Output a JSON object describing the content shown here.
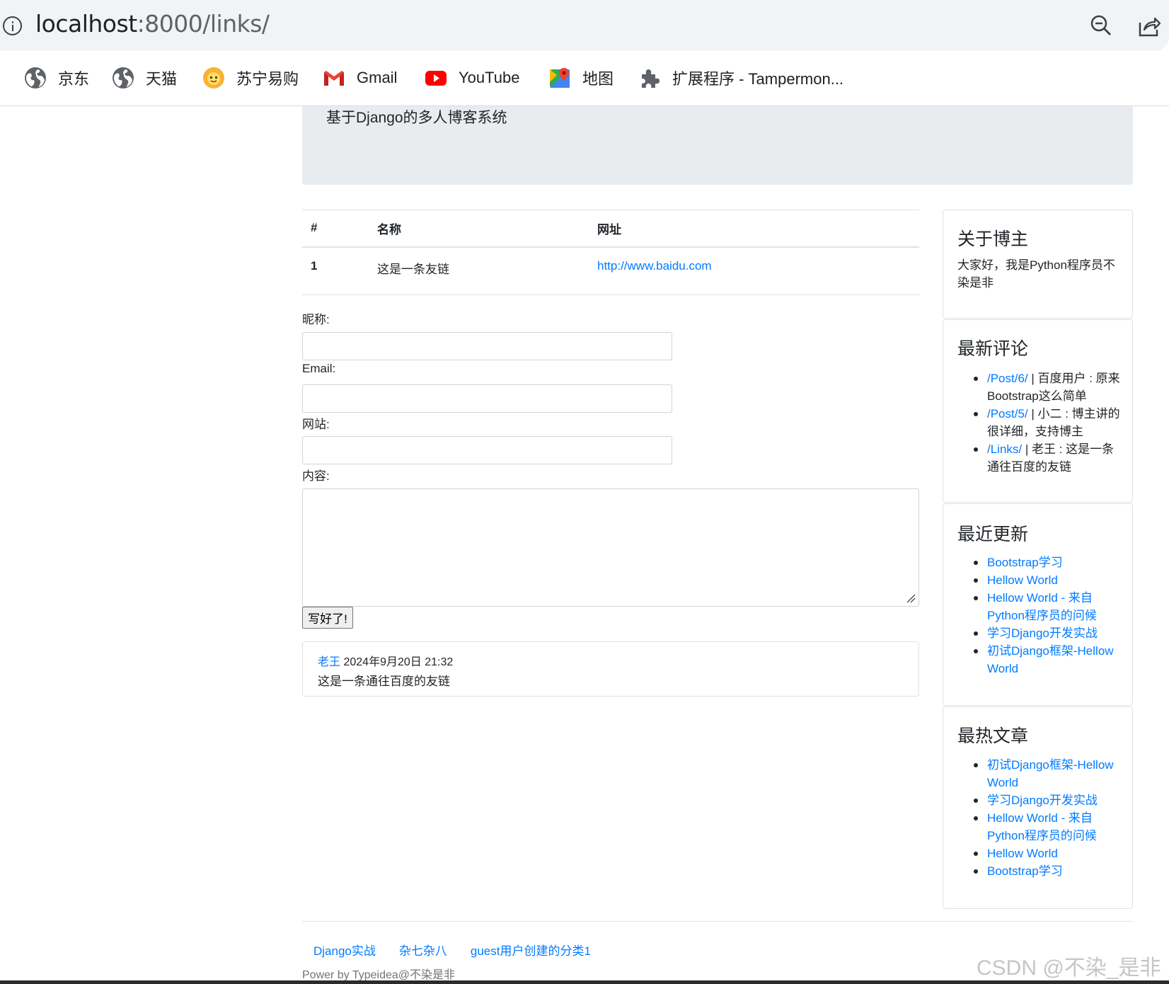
{
  "browser": {
    "url_host": "localhost",
    "url_path": ":8000/links/",
    "bookmarks": [
      {
        "label": "京东",
        "icon": "globe-icon"
      },
      {
        "label": "天猫",
        "icon": "globe-icon"
      },
      {
        "label": "苏宁易购",
        "icon": "suning-lion-icon"
      },
      {
        "label": "Gmail",
        "icon": "gmail-icon"
      },
      {
        "label": "YouTube",
        "icon": "youtube-icon"
      },
      {
        "label": "地图",
        "icon": "maps-icon"
      },
      {
        "label": "扩展程序 - Tampermon...",
        "icon": "puzzle-icon"
      }
    ]
  },
  "jumbotron": {
    "subtitle": "基于Django的多人博客系统"
  },
  "links_table": {
    "headers": [
      "#",
      "名称",
      "网址"
    ],
    "rows": [
      {
        "num": "1",
        "name": "这是一条友链",
        "url": "http://www.baidu.com"
      }
    ]
  },
  "comment_form": {
    "nickname_label": "昵称:",
    "email_label": "Email:",
    "website_label": "网站:",
    "content_label": "内容:",
    "submit_label": "写好了!"
  },
  "comments": [
    {
      "author": "老王",
      "date": "2024年9月20日 21:32",
      "content": "这是一条通往百度的友链"
    }
  ],
  "sidebar": {
    "about": {
      "title": "关于博主",
      "text": "大家好，我是Python程序员不染是非"
    },
    "latest_comments": {
      "title": "最新评论",
      "items": [
        {
          "link": "/Post/6/",
          "text": " | 百度用户 : 原来Bootstrap这么简单"
        },
        {
          "link": "/Post/5/",
          "text": " | 小二 : 博主讲的很详细，支持博主"
        },
        {
          "link": "/Links/",
          "text": " | 老王 : 这是一条通往百度的友链"
        }
      ]
    },
    "recent_updates": {
      "title": "最近更新",
      "items": [
        "Bootstrap学习",
        "Hellow World",
        "Hellow World - 来自Python程序员的问候",
        "学习Django开发实战",
        "初试Django框架-Hellow World"
      ]
    },
    "hot_posts": {
      "title": "最热文章",
      "items": [
        "初试Django框架-Hellow World",
        "学习Django开发实战",
        "Hellow World - 来自Python程序员的问候",
        "Hellow World",
        "Bootstrap学习"
      ]
    }
  },
  "footer": {
    "categories": [
      "Django实战",
      "杂七杂八",
      "guest用户创建的分类1"
    ],
    "power": "Power by Typeidea@不染是非"
  },
  "watermark": "CSDN @不染_是非",
  "colors": {
    "link": "#007bff",
    "jumbotron_bg": "#e9ecef",
    "border": "#dee2e6"
  }
}
